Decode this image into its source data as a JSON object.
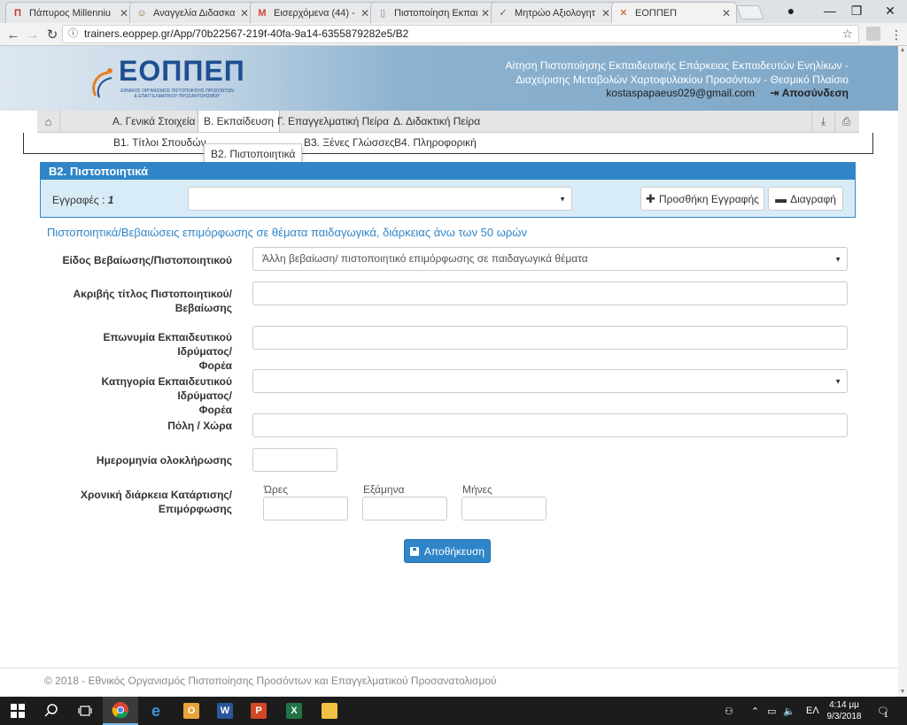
{
  "browser": {
    "tabs": [
      {
        "title": "Πάπυρος Millenniu",
        "favicon": "papyros-favicon",
        "icon": "Π",
        "color": "#c0392b",
        "active": false
      },
      {
        "title": "Αναγγελία Διδασκα",
        "favicon": "people-favicon",
        "icon": "☺",
        "color": "#8e6b2a",
        "active": false
      },
      {
        "title": "Εισερχόμενα (44) - ε",
        "favicon": "gmail-favicon",
        "icon": "M",
        "color": "#d44638",
        "active": false
      },
      {
        "title": "Πιστοποίηση Εκπαιδ",
        "favicon": "page-favicon",
        "icon": "▯",
        "color": "#888888",
        "active": false
      },
      {
        "title": "Μητρώο Αξιολογητ",
        "favicon": "check-favicon",
        "icon": "✓",
        "color": "#7a5a2a",
        "active": false
      },
      {
        "title": "ΕΟΠΠΕΠ",
        "favicon": "eoppep-favicon",
        "icon": "✕",
        "color": "#d35400",
        "active": true
      }
    ],
    "url": "trainers.eoppep.gr/App/70b22567-219f-40fa-9a14-6355879282e5/B2"
  },
  "header": {
    "logo_text": "ΕΟΠΠΕΠ",
    "logo_subtitle": "ΕΘΝΙΚΟΣ ΟΡΓΑΝΙΣΜΟΣ ΠΙΣΤΟΠΟΙΗΣΗΣ ΠΡΟΣΟΝΤΩΝ & ΕΠΑΓΓΕΛΜΑΤΙΚΟΥ ΠΡΟΣΑΝΤΟΛΙΣΜΟΥ",
    "title_line1": "Αίτηση Πιστοποίησης Εκπαιδευτικής Επάρκειας Εκπαιδευτών Ενηλίκων -",
    "title_line2": "Διαχείρισης Μεταβολών Χαρτοφυλακίου Προσόντων - Θεσμικό Πλαίσιο",
    "user_email": "kostaspapaeus029@gmail.com",
    "logout_label": "Αποσύνδεση"
  },
  "main_nav": {
    "items": [
      {
        "label": "Α. Γενικά Στοιχεία",
        "active": false
      },
      {
        "label": "Β. Εκπαίδευση",
        "active": true
      },
      {
        "label": "Γ. Επαγγελματική Πείρα",
        "active": false
      },
      {
        "label": "Δ. Διδακτική Πείρα",
        "active": false
      }
    ]
  },
  "sub_nav": {
    "items": [
      {
        "label": "Β1. Τίτλοι Σπουδών"
      },
      {
        "label": "Β3. Ξένες Γλώσσες"
      },
      {
        "label": "Β4. Πληροφορική"
      }
    ],
    "tooltip": "Β2. Πιστοποιητικά"
  },
  "panel": {
    "title": "Β2. Πιστοποιητικά",
    "records_label": "Εγγραφές :",
    "records_count": "1",
    "record_select_value": "",
    "add_button": "Προσθήκη Εγγραφής",
    "delete_button": "Διαγραφή"
  },
  "form": {
    "section_title": "Πιστοποιητικά/Βεβαιώσεις επιμόρφωσης σε θέματα παιδαγωγικά, διάρκειας άνω των 50 ωρών",
    "type_label": "Είδος Βεβαίωσης/Πιστοποιητικού",
    "type_value": "Άλλη βεβαίωση/ πιστοποιητικό επιμόρφωσης σε παιδαγωγικά θέματα",
    "title_label_1": "Ακριβής τίτλος Πιστοποιητικού/",
    "title_label_2": "Βεβαίωσης",
    "title_value": "",
    "institution_label_1": "Επωνυμία Εκπαιδευτικού Ιδρύματος/",
    "institution_label_2": "Φορέα",
    "institution_value": "",
    "category_label_1": "Κατηγορία Εκπαιδευτικού Ιδρύματος/",
    "category_label_2": "Φορέα",
    "category_value": "",
    "city_label": "Πόλη / Χώρα",
    "city_value": "",
    "date_label": "Ημερομηνία ολοκλήρωσης",
    "date_value": "",
    "duration_label_1": "Χρονική διάρκεια Κατάρτισης/",
    "duration_label_2": "Επιμόρφωσης",
    "hours_label": "Ώρες",
    "semesters_label": "Εξάμηνα",
    "months_label": "Μήνες",
    "hours_value": "",
    "semesters_value": "",
    "months_value": "",
    "save_button": "Αποθήκευση"
  },
  "footer": {
    "text": "© 2018 - Εθνικός Οργανισμός Πιστοποίησης Προσόντων και Επαγγελματικού Προσανατολισμού"
  },
  "taskbar": {
    "language": "ΕΛ",
    "time": "4:14 μμ",
    "date": "9/3/2018",
    "notification_count": "1"
  },
  "colors": {
    "accent_blue": "#2f85c8",
    "panel_bg": "#d8ecf8",
    "logo_blue": "#1f4f91"
  }
}
